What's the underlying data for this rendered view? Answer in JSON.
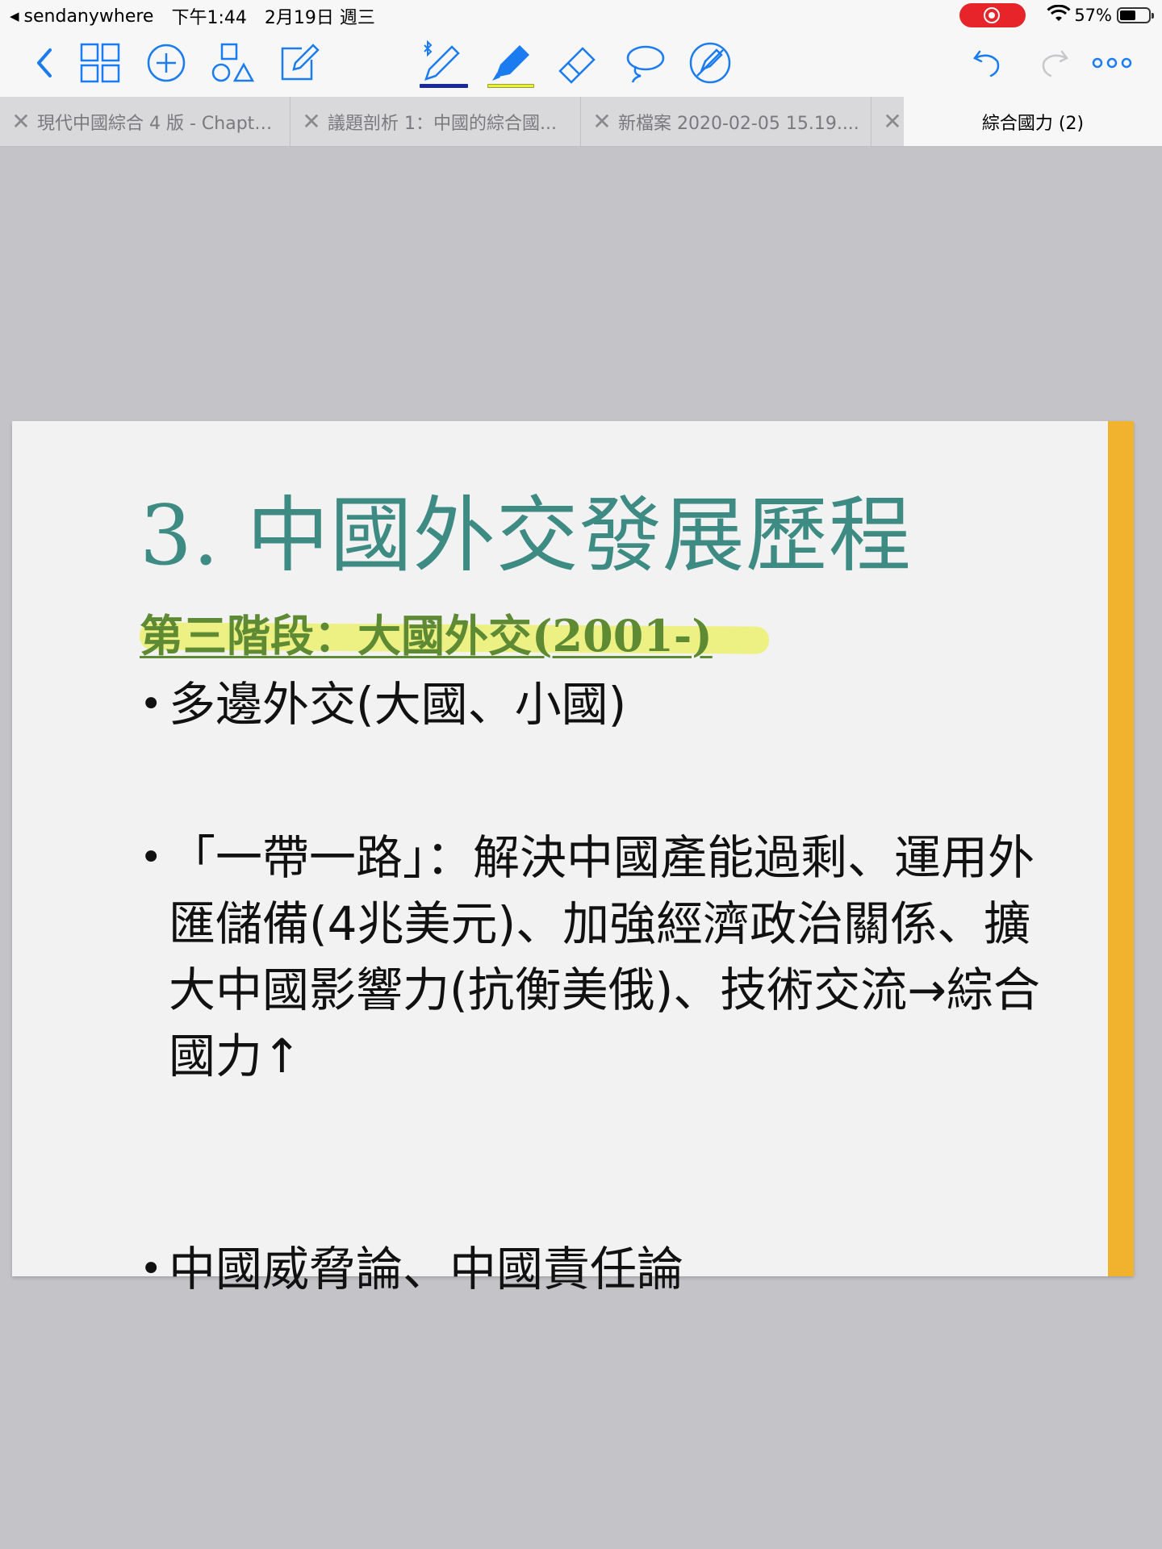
{
  "status_bar": {
    "back_app": "sendanywhere",
    "time": "下午1:44",
    "date": "2月19日 週三",
    "battery_percent": "57%",
    "battery_level": 0.57
  },
  "toolbar": {
    "icons": [
      "back-chevron-icon",
      "thumbnails-grid-icon",
      "add-circle-icon",
      "shapes-icon",
      "edit-compose-icon",
      "pen-bluetooth-icon",
      "highlighter-icon",
      "eraser-icon",
      "lasso-icon",
      "disable-touch-icon",
      "undo-icon",
      "redo-icon",
      "more-icon"
    ],
    "pen_color": "#1a2a9c",
    "highlighter_color": "#e9f03a",
    "accent": "#1a7cf0"
  },
  "tabs": [
    {
      "label": "現代中國綜合 4 版 - Chapte...",
      "active": false
    },
    {
      "label": "議題剖析 1：中國的綜合國...",
      "active": false
    },
    {
      "label": "新檔案 2020-02-05 15.19....",
      "active": false
    },
    {
      "label": "綜合國力 (2)",
      "active": true
    }
  ],
  "slide": {
    "title": "3. 中國外交發展歷程",
    "subheading": "第三階段：大國外交(2001-)",
    "bullets": [
      "多邊外交(大國、小國)",
      "「一帶一路」：解決中國產能過剩、運用外匯儲備(4兆美元)、加強經濟政治關係、擴大中國影響力(抗衡美俄)、技術交流→綜合國力↑",
      "中國威脅論、中國責任論"
    ],
    "bullet_symbol": "•",
    "title_color": "#3d8b83",
    "subheading_color": "#5e8a34",
    "side_bar_color": "#f1b22d"
  }
}
